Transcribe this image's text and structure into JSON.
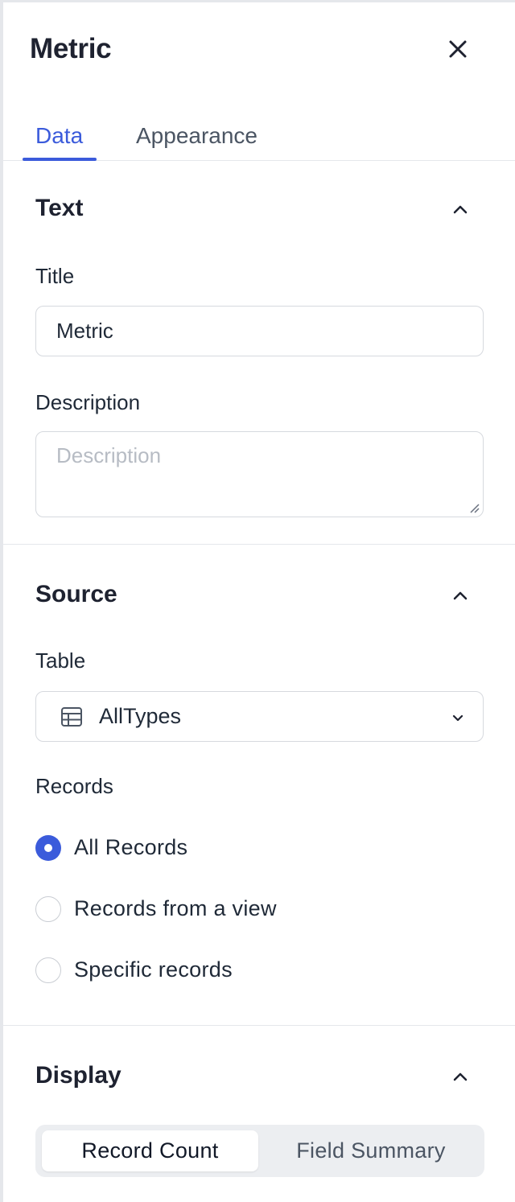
{
  "header": {
    "title": "Metric"
  },
  "tabs": [
    {
      "label": "Data",
      "active": true
    },
    {
      "label": "Appearance",
      "active": false
    }
  ],
  "text_section": {
    "title": "Text",
    "title_field_label": "Title",
    "title_value": "Metric",
    "description_label": "Description",
    "description_value": "",
    "description_placeholder": "Description"
  },
  "source_section": {
    "title": "Source",
    "table_label": "Table",
    "table_value": "AllTypes",
    "records_label": "Records",
    "records_options": [
      {
        "label": "All Records",
        "selected": true
      },
      {
        "label": "Records from a view",
        "selected": false
      },
      {
        "label": "Specific records",
        "selected": false
      }
    ]
  },
  "display_section": {
    "title": "Display",
    "options": [
      {
        "label": "Record Count",
        "selected": true
      },
      {
        "label": "Field Summary",
        "selected": false
      }
    ]
  },
  "colors": {
    "accent": "#3b5bdb",
    "border": "#d6d9de",
    "divider": "#e5e7eb",
    "segmented_bg": "#eceef1"
  },
  "icons": {
    "close": "close-icon",
    "collapse": "chevron-up-icon",
    "table": "table-icon",
    "dropdown": "chevron-down-icon"
  }
}
